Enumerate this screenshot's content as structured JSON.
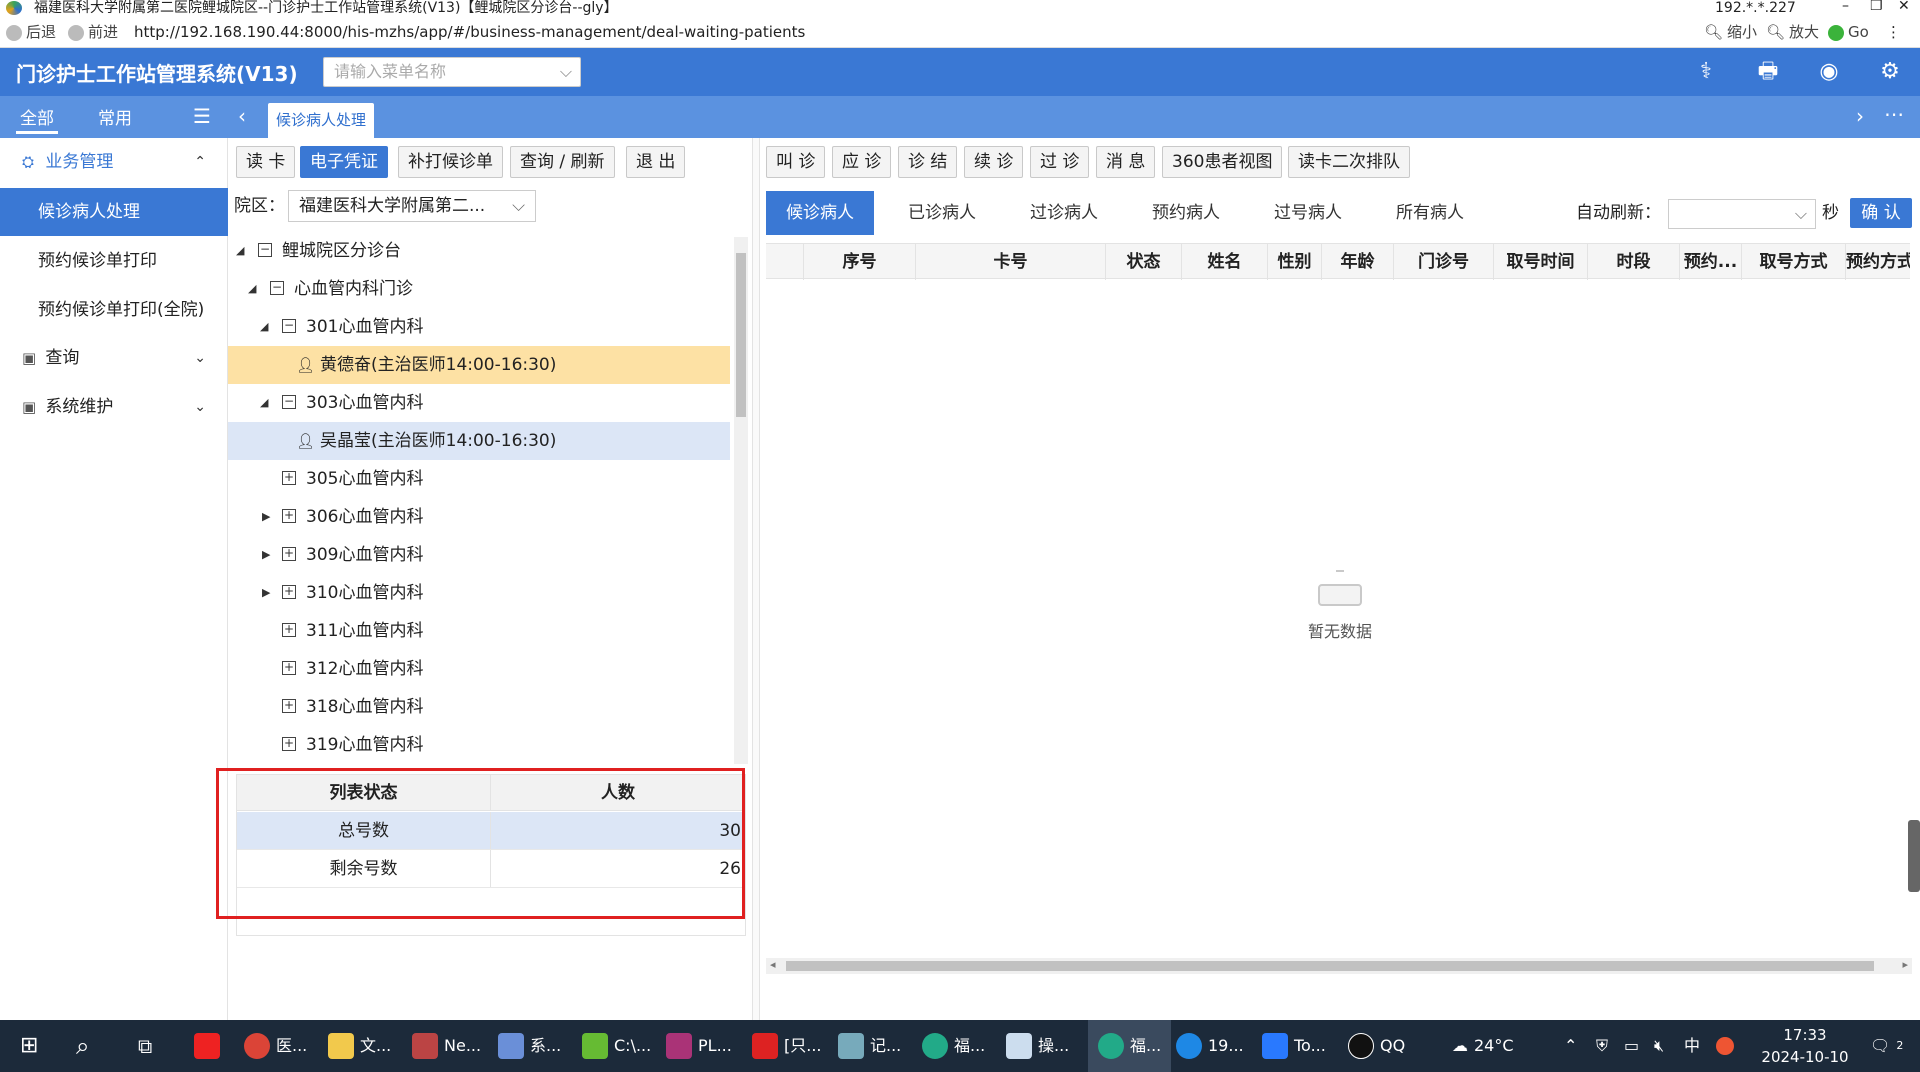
{
  "window": {
    "title": "福建医科大学附属第二医院鲤城院区--门诊护士工作站管理系统(V13)【鲤城院区分诊台--gly】",
    "ip": "192.*.*.227"
  },
  "browser": {
    "back": "后退",
    "forward": "前进",
    "url": "http://192.168.190.44:8000/his-mzhs/app/#/business-management/deal-waiting-patients",
    "zoom_out": "缩小",
    "zoom_in": "放大",
    "go": "Go"
  },
  "app": {
    "brand": "门诊护士工作站管理系统(V13)",
    "menu_search_placeholder": "请输入菜单名称"
  },
  "top_tabs": {
    "all": "全部",
    "common": "常用",
    "open_tab": "候诊病人处理"
  },
  "sidebar": {
    "group_business": "业务管理",
    "items": [
      "候诊病人处理",
      "预约候诊单打印",
      "预约候诊单打印(全院)"
    ],
    "group_query": "查询",
    "group_system": "系统维护"
  },
  "middle_toolbar": [
    "读 卡",
    "电子凭证",
    "补打候诊单",
    "查询 / 刷新",
    "退 出"
  ],
  "campus": {
    "label": "院区：",
    "value": "福建医科大学附属第二..."
  },
  "tree": [
    {
      "label": "鲤城院区分诊台"
    },
    {
      "label": "心血管内科门诊"
    },
    {
      "label": "301心血管内科"
    },
    {
      "label": "黄德奋(主治医师14:00-16:30)"
    },
    {
      "label": "303心血管内科"
    },
    {
      "label": "吴晶莹(主治医师14:00-16:30)"
    },
    {
      "label": "305心血管内科"
    },
    {
      "label": "306心血管内科"
    },
    {
      "label": "309心血管内科"
    },
    {
      "label": "310心血管内科"
    },
    {
      "label": "311心血管内科"
    },
    {
      "label": "312心血管内科"
    },
    {
      "label": "318心血管内科"
    },
    {
      "label": "319心血管内科"
    }
  ],
  "stats": {
    "col1": "列表状态",
    "col2": "人数",
    "rows": [
      {
        "name": "总号数",
        "value": "30"
      },
      {
        "name": "剩余号数",
        "value": "26"
      }
    ]
  },
  "right_toolbar": [
    "叫 诊",
    "应 诊",
    "诊 结",
    "续 诊",
    "过 诊",
    "消 息",
    "360患者视图",
    "读卡二次排队"
  ],
  "patient_tabs": [
    "候诊病人",
    "已诊病人",
    "过诊病人",
    "预约病人",
    "过号病人",
    "所有病人"
  ],
  "auto_refresh": {
    "label": "自动刷新：",
    "unit": "秒",
    "confirm": "确 认"
  },
  "grid_columns": [
    "序号",
    "卡号",
    "状态",
    "姓名",
    "性别",
    "年龄",
    "门诊号",
    "取号时间",
    "时段",
    "预约...",
    "取号方式",
    "预约方式"
  ],
  "empty_text": "暂无数据",
  "taskbar": {
    "items": [
      "医...",
      "文...",
      "Ne...",
      "系...",
      "C:\\...",
      "PL...",
      "[只...",
      "记...",
      "福...",
      "操...",
      "福...",
      "19...",
      "To...",
      "QQ"
    ],
    "weather": "24°C",
    "ime": "中",
    "time": "17:33",
    "date": "2024-10-10",
    "notif": "2"
  },
  "colors": {
    "primary": "#3a78d4",
    "highlight_row": "#fde1a4",
    "selected_row": "#dce6f6",
    "red_box": "#e02020"
  }
}
